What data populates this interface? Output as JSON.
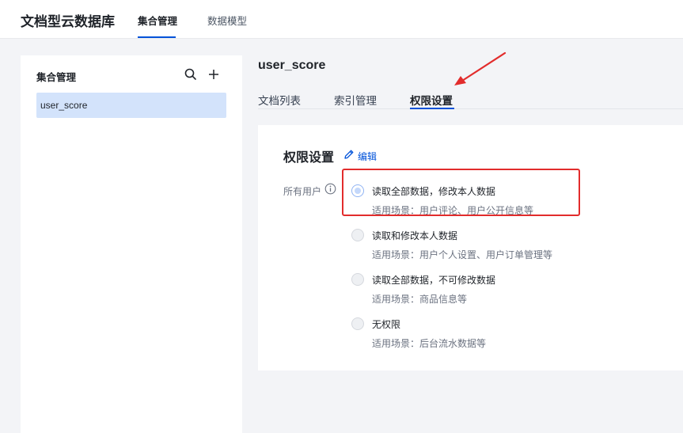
{
  "header": {
    "app_title": "文档型云数据库",
    "tabs": [
      {
        "label": "集合管理",
        "active": true
      },
      {
        "label": "数据模型",
        "active": false
      }
    ]
  },
  "sidebar": {
    "title": "集合管理",
    "search_icon": "search-icon",
    "add_icon": "plus-icon",
    "items": [
      {
        "label": "user_score",
        "selected": true
      }
    ]
  },
  "main": {
    "collection_name": "user_score",
    "tabs": [
      {
        "label": "文档列表",
        "active": false
      },
      {
        "label": "索引管理",
        "active": false
      },
      {
        "label": "权限设置",
        "active": true
      }
    ]
  },
  "permissions": {
    "title": "权限设置",
    "edit_label": "编辑",
    "field_label": "所有用户",
    "selected_index": 0,
    "options": [
      {
        "label": "读取全部数据，修改本人数据",
        "desc": "适用场景：用户评论、用户公开信息等"
      },
      {
        "label": "读取和修改本人数据",
        "desc": "适用场景：用户个人设置、用户订单管理等"
      },
      {
        "label": "读取全部数据，不可修改数据",
        "desc": "适用场景：商品信息等"
      },
      {
        "label": "无权限",
        "desc": "适用场景：后台流水数据等"
      }
    ]
  },
  "colors": {
    "accent": "#0052d9",
    "annotation": "#e22c2c",
    "selected_bg": "#d3e3fb"
  }
}
